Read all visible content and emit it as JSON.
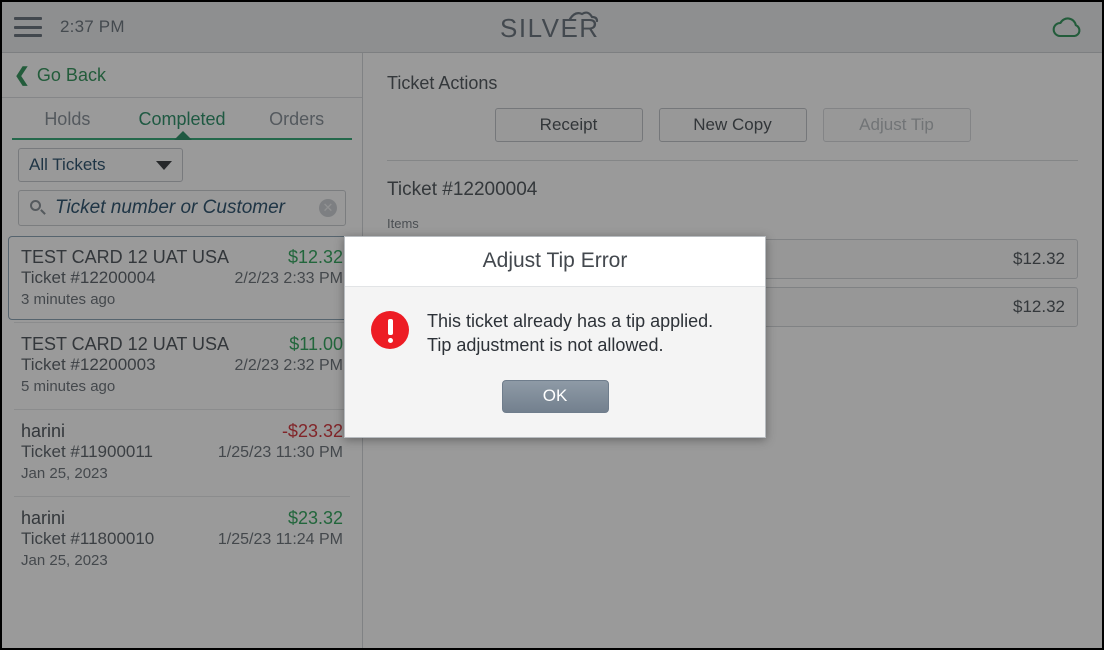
{
  "topbar": {
    "menu_icon": "hamburger-icon",
    "time": "2:37 PM",
    "logo_text": "SILVER",
    "cloud_icon": "cloud-icon",
    "cloud_color": "#1f8a4c"
  },
  "sidebar": {
    "go_back": "Go Back",
    "back_icon": "chevron-left-icon",
    "tabs": [
      {
        "label": "Holds",
        "active": false
      },
      {
        "label": "Completed",
        "active": true
      },
      {
        "label": "Orders",
        "active": false
      }
    ],
    "filter": {
      "selected": "All Tickets",
      "caret_icon": "chevron-down-icon"
    },
    "search": {
      "placeholder": "Ticket number or Customer",
      "value": "",
      "search_icon": "search-icon",
      "clear_icon": "clear-circle-icon"
    },
    "tickets": [
      {
        "customer": "TEST CARD 12 UAT USA",
        "amount": "$12.32",
        "amount_sign": "pos",
        "number": "Ticket #12200004",
        "datetime": "2/2/23 2:33 PM",
        "ago": "3 minutes ago",
        "selected": true
      },
      {
        "customer": "TEST CARD 12 UAT USA",
        "amount": "$11.00",
        "amount_sign": "pos",
        "number": "Ticket #12200003",
        "datetime": "2/2/23 2:32 PM",
        "ago": "5 minutes ago",
        "selected": false
      },
      {
        "customer": "harini",
        "amount": "-$23.32",
        "amount_sign": "neg",
        "number": "Ticket #11900011",
        "datetime": "1/25/23 11:30 PM",
        "ago": "Jan 25, 2023",
        "selected": false
      },
      {
        "customer": "harini",
        "amount": "$23.32",
        "amount_sign": "pos",
        "number": "Ticket #11800010",
        "datetime": "1/25/23 11:24 PM",
        "ago": "Jan 25, 2023",
        "selected": false
      }
    ]
  },
  "main": {
    "actions_title": "Ticket Actions",
    "actions": [
      {
        "label": "Receipt",
        "disabled": false
      },
      {
        "label": "New Copy",
        "disabled": false
      },
      {
        "label": "Adjust Tip",
        "disabled": true
      }
    ],
    "ticket_heading": "Ticket #12200004",
    "items_label": "Items",
    "items": [
      {
        "name": "",
        "amount": "$12.32"
      },
      {
        "name": "",
        "amount": "$12.32"
      }
    ]
  },
  "dialog": {
    "title": "Adjust Tip Error",
    "icon": "error-icon",
    "icon_color": "#ed1c24",
    "message": "This ticket already has a tip applied. Tip adjustment is not allowed.",
    "ok_label": "OK"
  },
  "colors": {
    "accent_green": "#17855a",
    "positive": "#1e9d4e",
    "negative": "#d0232b",
    "link_blue": "#17405f"
  }
}
